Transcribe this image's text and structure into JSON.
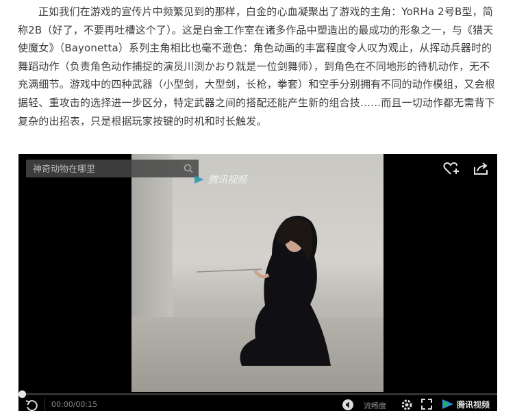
{
  "article": {
    "paragraph": "正如我们在游戏的宣传片中频繁见到的那样，白金的心血凝聚出了游戏的主角：YoRHa 2号B型，简称2B（好了，不要再吐槽这个了）。这是白金工作室在诸多作品中塑造出的最成功的形象之一，与《猎天使魔女》（Bayonetta）系列主角相比也毫不逊色：角色动画的丰富程度令人叹为观止，从挥动兵器时的舞蹈动作（负责角色动作捕捉的演员川渕かおり就是一位剑舞师），到角色在不同地形的待机动作，无不充满细节。游戏中的四种武器（小型剑，大型剑，长枪，拳套）和空手分别拥有不同的动作模组，又会根据轻、重攻击的选择进一步区分，特定武器之间的搭配还能产生新的组合技……而且一切动作都无需背下复杂的出招表，只是根据玩家按键的时机和时长触发。"
  },
  "player": {
    "search_placeholder": "神奇动物在哪里",
    "watermark": "腾讯视频",
    "time_current": "00:00",
    "time_total": "00:15",
    "quality_label": "流畅度",
    "brand_label": "腾讯视频",
    "colors": {
      "background": "#000000",
      "accent_green": "#1fb352",
      "accent_blue": "#2f8ae0"
    }
  }
}
